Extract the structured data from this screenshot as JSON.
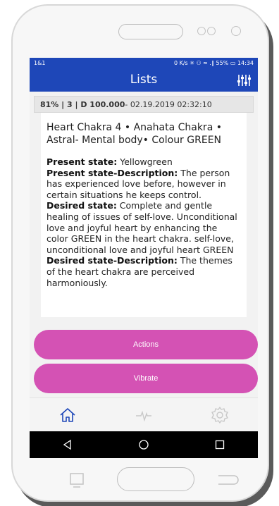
{
  "status": {
    "carrier": "1&1",
    "right": "0 K/s ✳ ⚇ ≈ .∥ 55% ▭ 14:34"
  },
  "appbar": {
    "title": "Lists"
  },
  "card": {
    "header_bold": "81% | 3 | D 100.000",
    "header_date": " - 02.19.2019 02:32:10",
    "title": "Heart Chakra 4 • Anahata Chakra • Astral- Mental body• Colour GREEN",
    "fields": [
      {
        "label": "Present state:",
        "value": " Yellowgreen"
      },
      {
        "label": "Present state-Description:",
        "value": " The person has experienced love before, however in certain situations he keeps control."
      },
      {
        "label": "Desired state:",
        "value": " Complete and gentle healing of issues of self-love. Unconditional love and joyful heart by enhancing the color GREEN in the heart chakra. self-love, unconditional love and joyful heart GREEN"
      },
      {
        "label": "Desired state-Description:",
        "value": " The themes of the heart chakra are perceived harmoniously."
      }
    ]
  },
  "buttons": {
    "actions": "Actions",
    "vibrate": "Vibrate"
  },
  "colors": {
    "primary": "#1e47b8",
    "accent": "#d452b4"
  },
  "bottom_nav": [
    "home-icon",
    "pulse-icon",
    "settings-icon"
  ]
}
